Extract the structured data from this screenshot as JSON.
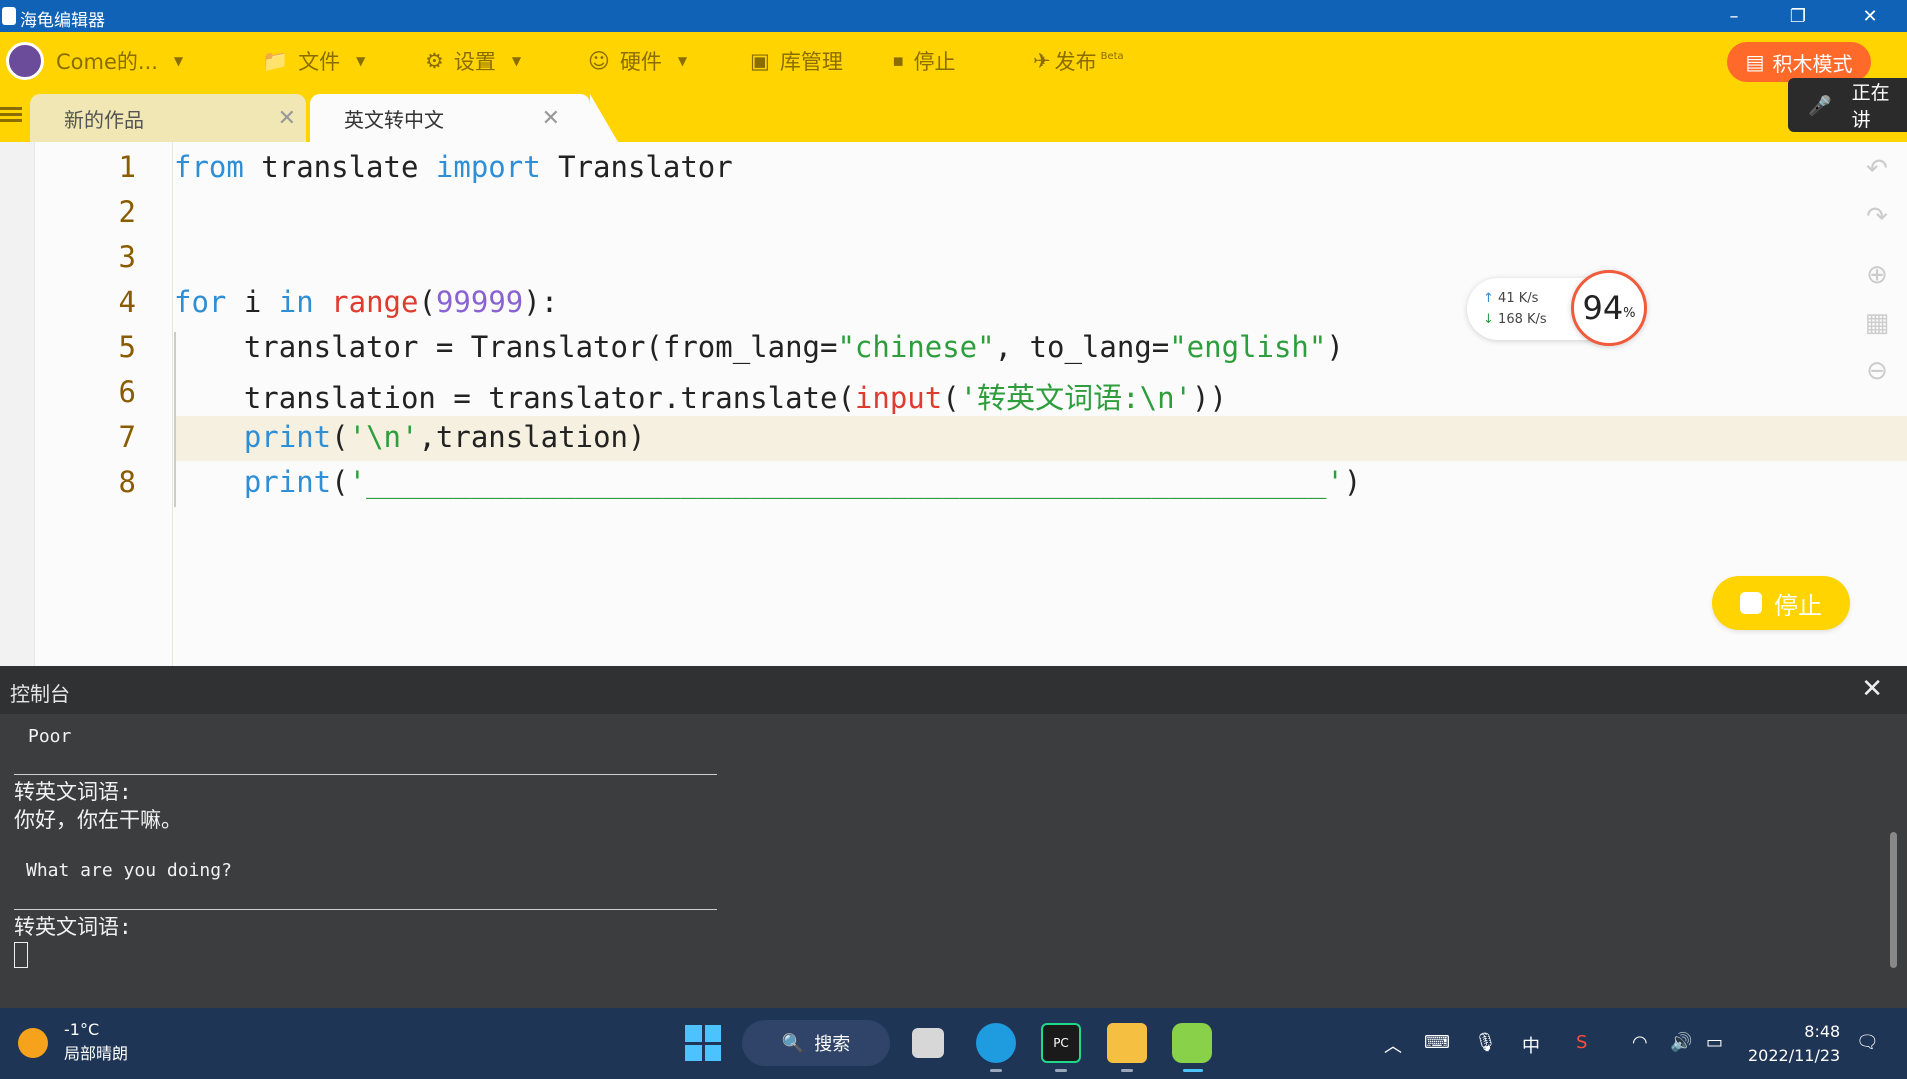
{
  "window": {
    "title": "海龟编辑器"
  },
  "menubar": {
    "user_label": "Come的...",
    "file": "文件",
    "settings": "设置",
    "hardware": "硬件",
    "library": "库管理",
    "stop": "停止",
    "publish": "发布",
    "publish_badge": "Beta",
    "block_mode": "积木模式"
  },
  "voice": {
    "label": "正在讲"
  },
  "tabs": [
    {
      "label": "新的作品"
    },
    {
      "label": "英文转中文"
    }
  ],
  "editor": {
    "line_numbers": [
      "1",
      "2",
      "3",
      "4",
      "5",
      "6",
      "7",
      "8"
    ]
  },
  "network": {
    "up": "41  K/s",
    "down": "168 K/s",
    "cpu": "94",
    "cpu_unit": "%"
  },
  "floating": {
    "stop": "停止"
  },
  "console": {
    "title": "控制台",
    "lines": [
      "Poor",
      "转英文词语:",
      "你好，你在干嘛。",
      "What are you doing?",
      "转英文词语:"
    ]
  },
  "taskbar": {
    "temp": "-1°C",
    "weather": "局部晴朗",
    "search": "搜索",
    "ime": "中",
    "time": "8:48",
    "date": "2022/11/23"
  },
  "colors": {
    "accent": "#ffd400",
    "titlebar": "#0f62b6",
    "console": "#3c3d3e",
    "taskbar": "#1f3556"
  }
}
